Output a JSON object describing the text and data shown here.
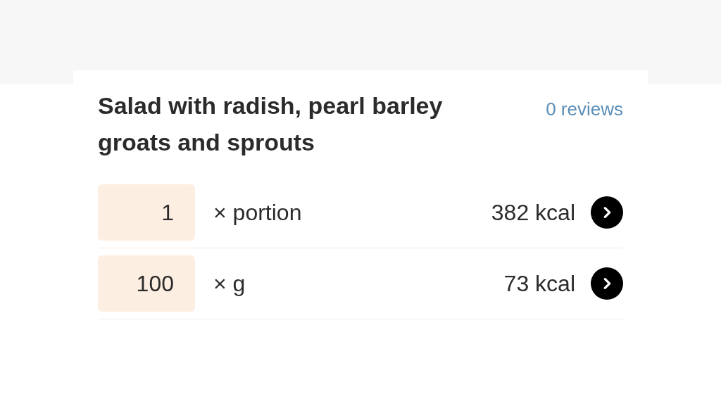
{
  "recipe": {
    "title": "Salad with radish, pearl barley groats and sprouts",
    "reviews": "0 reviews"
  },
  "servings": [
    {
      "amount": "1",
      "unit": "× portion",
      "energy": "382 kcal"
    },
    {
      "amount": "100",
      "unit": "× g",
      "energy": "73 kcal"
    }
  ]
}
